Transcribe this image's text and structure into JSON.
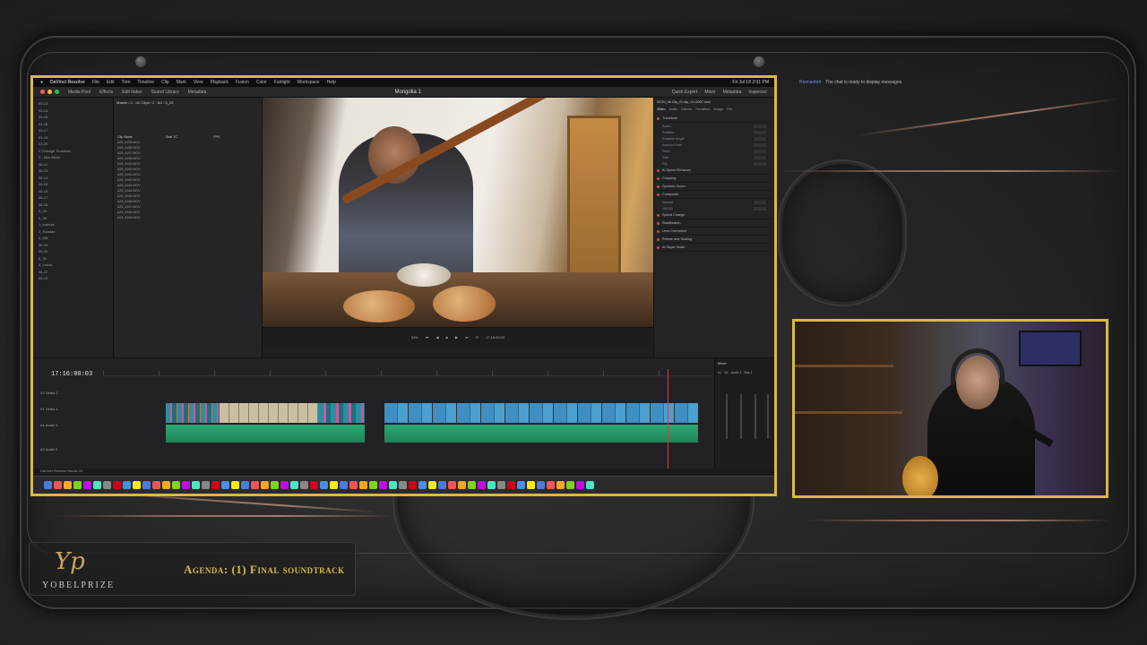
{
  "app": {
    "name": "DaVinci Resolve",
    "menu": [
      "File",
      "Edit",
      "Trim",
      "Timeline",
      "Clip",
      "Mark",
      "View",
      "Playback",
      "Fusion",
      "Color",
      "Fairlight",
      "Workspace",
      "Help"
    ],
    "clock": "Fri Jul 18 2:01 PM",
    "project_title": "Mongolia 1",
    "toolbar_left": [
      "Media Pool",
      "Effects",
      "Edit Index",
      "Sound Library",
      "Metadata"
    ],
    "toolbar_right": [
      "Quick Export",
      "Mixer",
      "Metadata",
      "Inspector"
    ],
    "zoom": "34%",
    "viewer_tc_left": "18:00:01:01",
    "viewer_tc_right": "17:16:00:03",
    "timeline_name": "Mongolia Timeline",
    "clip_file": "00:20_4k 24p_r5 clip_V1-0007.mov",
    "bin_path": "Master / 2 - MJ Clips / 2 - MJ / 5_26",
    "statusbar": "DaVinci Resolve Studio 20"
  },
  "media_pool": {
    "col_headers": [
      "Clip Name",
      "Start TC",
      "FPS"
    ],
    "clips": [
      "A25_5155.MOV",
      "A25_5156.MOV",
      "A25_5157.MOV",
      "A25_5158.MOV",
      "A25_5159.MOV",
      "A25_5160.MOV",
      "A25_5161.MOV",
      "A25_5162.MOV",
      "A25_5163.MOV",
      "A25_5164.MOV",
      "A25_5165.MOV",
      "A25_5166.MOV",
      "A25_5167.MOV",
      "A25_5168.MOV",
      "A25_5169.MOV"
    ]
  },
  "sidebar_items": [
    "03-13",
    "03-14",
    "03-15",
    "03-16",
    "03-17",
    "03-18",
    "03-20",
    "2 Footage Timelines",
    "3 - Mini Mixer",
    "06-12",
    "06-13",
    "06-14",
    "06-15",
    "06-16",
    "06-17",
    "06-18",
    "5_25",
    "5_26",
    "1_Kalmyk",
    "2_Tsaatan",
    "3_Mill",
    "06-19",
    "06-20",
    "5_30",
    "3_Leeds",
    "06-22",
    "06-23"
  ],
  "inspector": {
    "tabs": [
      "Video",
      "Audio",
      "Effects",
      "Transition",
      "Image",
      "File"
    ],
    "sections": [
      "Transform",
      "AI Speed Enhance",
      "Cropping",
      "Dynamic Zoom",
      "Composite",
      "Speed Change",
      "Stabilization",
      "Lens Correction",
      "Retime and Scaling",
      "AI Super Scale"
    ],
    "fields": [
      "Zoom",
      "Position",
      "Rotation Angle",
      "Anchor Point",
      "Pitch",
      "Yaw",
      "Flip"
    ],
    "composite_mode": "Normal",
    "opacity": "100.00"
  },
  "timeline": {
    "timecode": "17:16:00:03",
    "tracks": [
      "V2",
      "Video 2",
      "V1",
      "Video 1",
      "A1",
      "Audio 1",
      "A2",
      "Audio 2"
    ],
    "ruler_marks": [
      "17:13:00:00",
      "17:13:10:00",
      "17:13:20:00",
      "17:13:30:00",
      "17:13:40:00",
      "17:13:50:00",
      "17:14:00:00",
      "17:14:10:00",
      "17:14:20:00",
      "17:14:30:00",
      "17:14:40:00"
    ],
    "mixer_title": "Mixer",
    "mixer_channels": [
      "A1",
      "A2",
      "Audio 1",
      "Audio 2",
      "Bus 1"
    ]
  },
  "chat": {
    "user": "Reimanbot",
    "message": "The chat is ready to display messages"
  },
  "brand": {
    "glyph": "Yp",
    "name": "YOBELPRIZE",
    "agenda": "Agenda: (1) Final soundtrack"
  },
  "colors": {
    "accent": "#d9b84a",
    "copper": "#c48f72",
    "playhead": "#e0383f",
    "clip_teal": "#2a8fa0",
    "clip_pink": "#d0559a",
    "audio_green": "#2fa873"
  }
}
